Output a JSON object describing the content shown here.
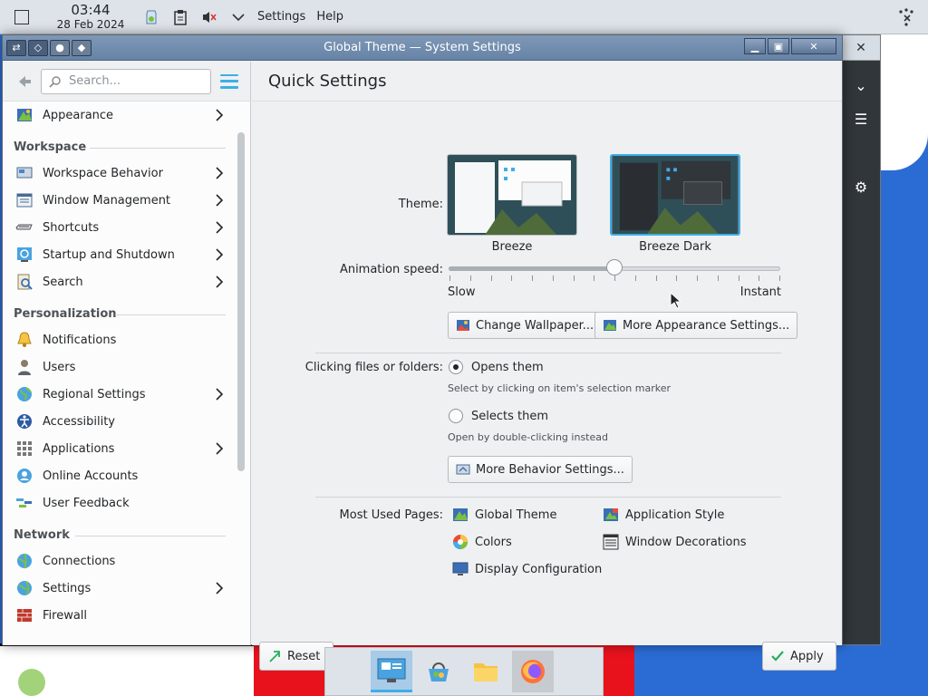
{
  "top_panel": {
    "time": "03:44",
    "date": "28 Feb 2024",
    "menus": [
      "Settings",
      "Help"
    ]
  },
  "window": {
    "title": "Global Theme — System Settings"
  },
  "sidebar": {
    "search_placeholder": "Search...",
    "items": [
      {
        "label": "Appearance",
        "icon": "appearance-icon",
        "chevron": true
      },
      {
        "section": "Workspace"
      },
      {
        "label": "Workspace Behavior",
        "icon": "workspace-icon",
        "chevron": true
      },
      {
        "label": "Window Management",
        "icon": "window-icon",
        "chevron": true
      },
      {
        "label": "Shortcuts",
        "icon": "keyboard-icon",
        "chevron": true
      },
      {
        "label": "Startup and Shutdown",
        "icon": "power-icon",
        "chevron": true
      },
      {
        "label": "Search",
        "icon": "search-icon",
        "chevron": true
      },
      {
        "section": "Personalization"
      },
      {
        "label": "Notifications",
        "icon": "bell-icon",
        "chevron": false
      },
      {
        "label": "Users",
        "icon": "user-icon",
        "chevron": false
      },
      {
        "label": "Regional Settings",
        "icon": "globe-icon",
        "chevron": true
      },
      {
        "label": "Accessibility",
        "icon": "accessibility-icon",
        "chevron": false
      },
      {
        "label": "Applications",
        "icon": "apps-icon",
        "chevron": true
      },
      {
        "label": "Online Accounts",
        "icon": "accounts-icon",
        "chevron": false
      },
      {
        "label": "User Feedback",
        "icon": "feedback-icon",
        "chevron": false
      },
      {
        "section": "Network"
      },
      {
        "label": "Connections",
        "icon": "network-icon",
        "chevron": false
      },
      {
        "label": "Settings",
        "icon": "network-settings-icon",
        "chevron": true
      },
      {
        "label": "Firewall",
        "icon": "firewall-icon",
        "chevron": false
      }
    ]
  },
  "content": {
    "page_title": "Quick Settings",
    "theme_label": "Theme:",
    "themes": [
      "Breeze",
      "Breeze Dark"
    ],
    "animation_label": "Animation speed:",
    "animation_speed": 0.5,
    "slow_label": "Slow",
    "instant_label": "Instant",
    "change_wallpaper": "Change Wallpaper...",
    "more_appearance": "More Appearance Settings...",
    "clicking_label": "Clicking files or folders:",
    "opens_them": "Opens them",
    "opens_hint": "Select by clicking on item's selection marker",
    "selects_them": "Selects them",
    "selects_hint": "Open by double-clicking instead",
    "more_behavior": "More Behavior Settings...",
    "most_used_label": "Most Used Pages:",
    "most_used": [
      "Global Theme",
      "Application Style",
      "Colors",
      "Window Decorations",
      "Display Configuration"
    ],
    "reset": "Reset",
    "apply": "Apply"
  },
  "colors": {
    "accent": "#3daee9",
    "titlebar": "#6f8bad"
  }
}
